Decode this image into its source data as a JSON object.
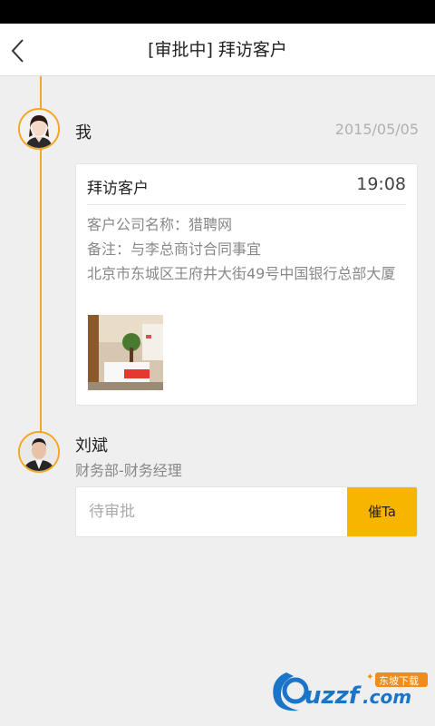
{
  "header": {
    "title": "[审批中] 拜访客户",
    "back_icon": "chevron-left-icon"
  },
  "applicant": {
    "name": "我",
    "date": "2015/05/05"
  },
  "visit_card": {
    "title": "拜访客户",
    "time": "19:08",
    "company_line": "客户公司名称：猎聘网",
    "note_line": "备注：与李总商讨合同事宜",
    "address_line": "北京市东城区王府井大街49号中国银行总部大厦"
  },
  "approver": {
    "name": "刘斌",
    "department": "财务部-财务经理",
    "status": "待审批",
    "urge_label": "催Ta"
  },
  "watermark": {
    "brand": "uzzf.com",
    "badge": "东坡下载"
  },
  "colors": {
    "accent": "#f5a623",
    "button": "#f7b500",
    "background": "#efefef"
  }
}
